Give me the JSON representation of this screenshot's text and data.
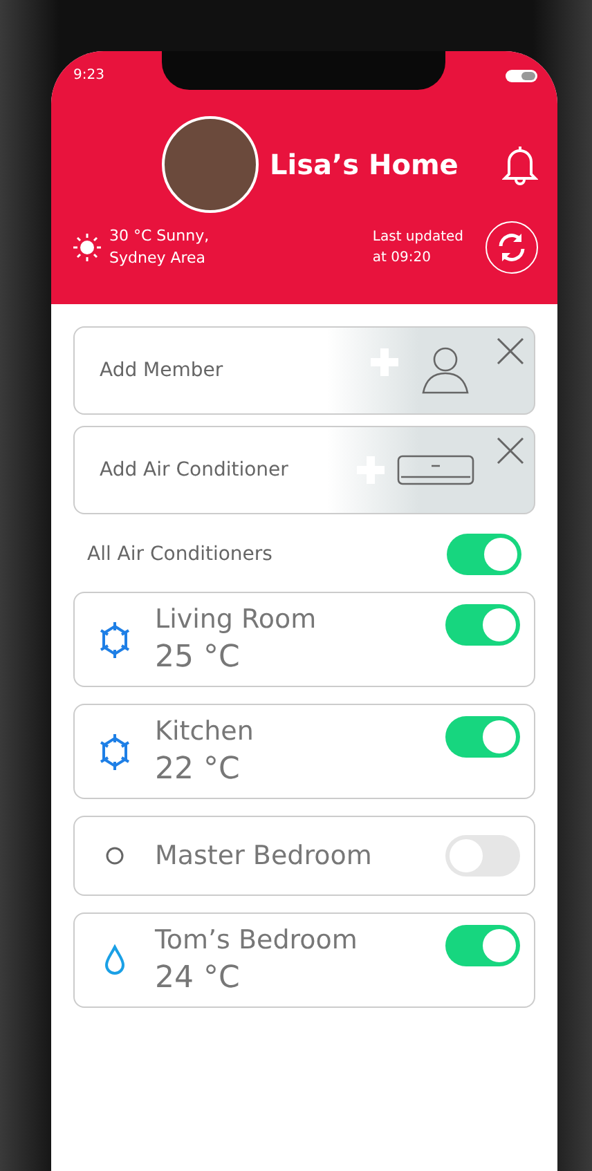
{
  "status_bar": {
    "time": "9:23"
  },
  "header": {
    "title": "Lisa’s Home",
    "weather": [
      "30 °C Sunny,",
      "Sydney Area"
    ],
    "last_updated": [
      "Last updated",
      "at 09:20"
    ]
  },
  "add_cards": [
    {
      "kind": "member",
      "label": "Add Member"
    },
    {
      "kind": "air_conditioner",
      "label": "Add Air Conditioner"
    }
  ],
  "all_air_conditioners": {
    "label": "All Air Conditioners",
    "on": true
  },
  "rooms": [
    {
      "name": "Living Room",
      "temperature": "25 °C",
      "kind": "cool",
      "on": true
    },
    {
      "name": "Kitchen",
      "temperature": "22 °C",
      "kind": "cool",
      "on": true
    },
    {
      "name": "Master Bedroom",
      "kind": "off",
      "on": false
    },
    {
      "name": "Tom’s Bedroom",
      "temperature": "24 °C",
      "kind": "dry",
      "on": true
    }
  ]
}
